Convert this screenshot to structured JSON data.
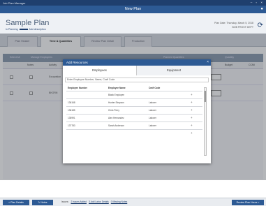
{
  "window": {
    "app_title": "Job Plan Manager",
    "controls": "– ▫ ×"
  },
  "header": {
    "title": "New Plan",
    "plan_name": "Sample Plan",
    "plan_sub_left": "In Planning",
    "plan_sub_right": "Add description",
    "saved_line1": "Plan Date: Thursday, March 5, 2018",
    "saved_line2": "BOB FROST DEPT"
  },
  "tabs": [
    {
      "label": "Plan Header"
    },
    {
      "label": "Time & Quantities"
    },
    {
      "label": "Review Plan Detail"
    },
    {
      "label": "Production"
    }
  ],
  "grid": {
    "header_cells": [
      "Select All",
      "Manage Employees",
      "Planned Quantities",
      "Quantity"
    ],
    "sub_cells": [
      "Notes",
      "Activity",
      "Budget",
      "CCMI"
    ],
    "rows": [
      {
        "activity": "Excavation"
      },
      {
        "activity": "BKGRN"
      }
    ]
  },
  "modal": {
    "title": "Add Resources",
    "close": "×",
    "tab_employees": "Employees",
    "tab_equipment": "Equipment",
    "search_placeholder": "Enter Employee Number, Name, Craft Code",
    "columns": [
      "Employee Number",
      "Employee Name",
      "Craft Code"
    ],
    "rows": [
      {
        "number": "",
        "name": "Blank Employee",
        "craft": "",
        "add": "+"
      },
      {
        "number": "136168",
        "name": "Hunter Simpson",
        "craft": "Laborer",
        "add": "+"
      },
      {
        "number": "136185",
        "name": "Chris Perry",
        "craft": "Laborer",
        "add": "+"
      },
      {
        "number": "135991",
        "name": "Alex Hernandez",
        "craft": "Laborer",
        "add": "+"
      },
      {
        "number": "137783",
        "name": "Sarah Anderson",
        "craft": "Laborer",
        "add": "+"
      },
      {
        "number": "",
        "name": "",
        "craft": "",
        "add": "+"
      }
    ]
  },
  "bottom": {
    "left_button": "< Plan Details",
    "notes_button": "✎ Notes",
    "status_prefix": "Issues:",
    "link1": "2 Issues Added",
    "link2": "3 Add Labor Details",
    "link3": "0 Missing Notes",
    "right_button": "Review Plan Hours >"
  },
  "colors": {
    "primary": "#2d5a94",
    "dark": "#1f3f6e"
  }
}
